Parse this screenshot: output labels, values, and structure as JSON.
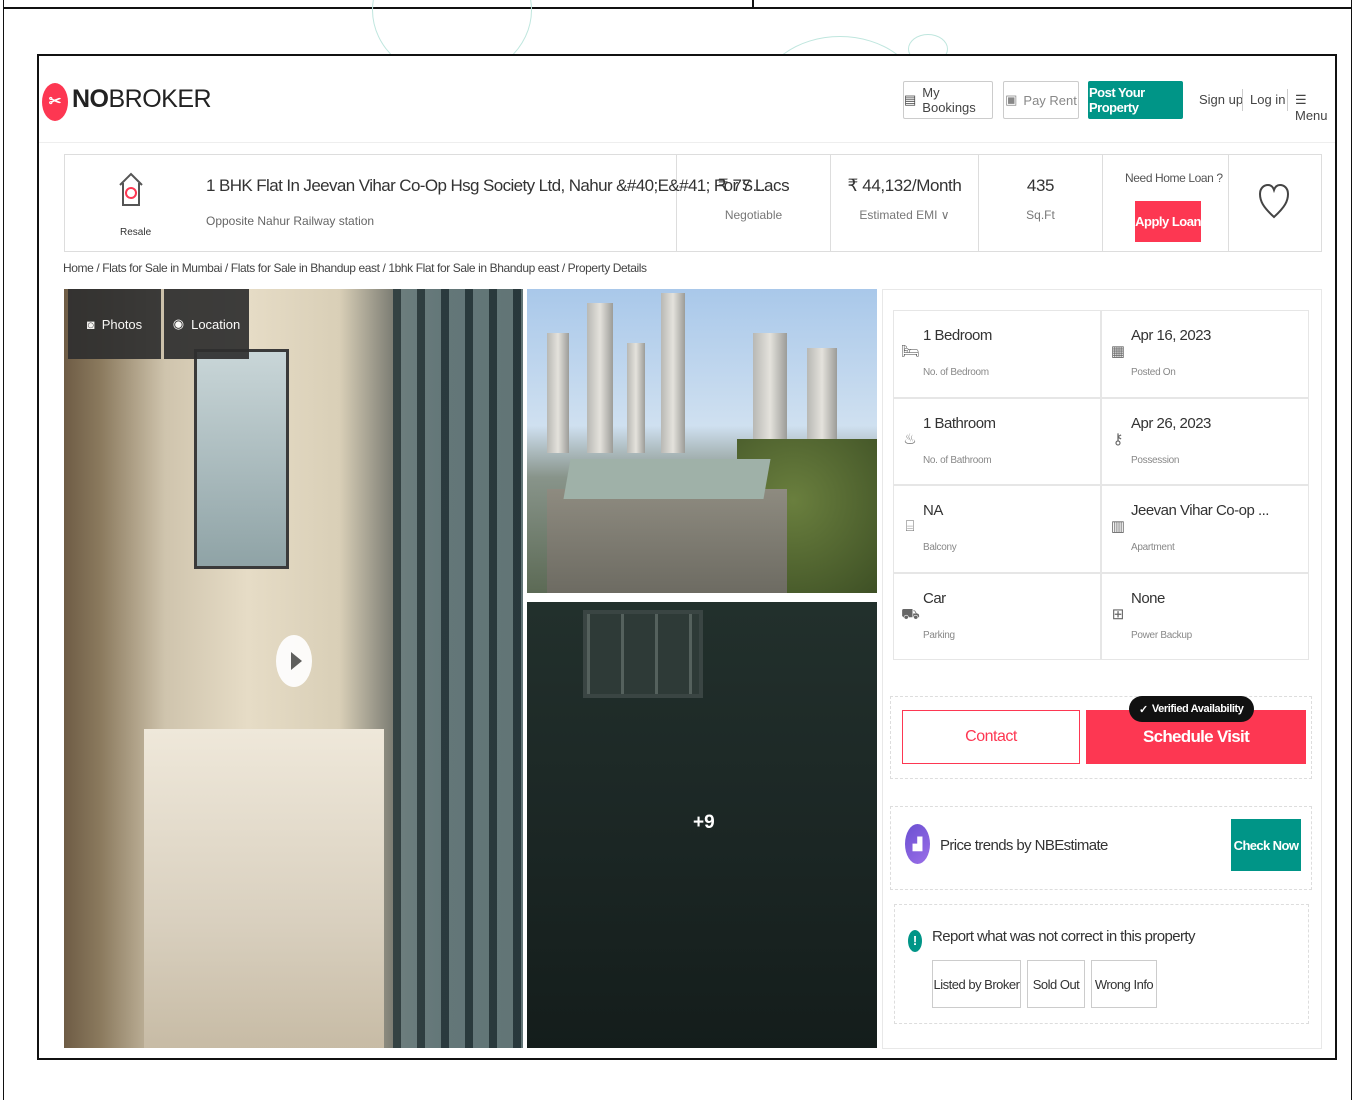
{
  "header": {
    "logo_mark": "✂",
    "logo_bold": "NO",
    "logo_rest": "BROKER",
    "my_bookings": "My Bookings",
    "pay_rent": "Pay Rent",
    "post_property": "Post Your Property",
    "sign_up": "Sign up",
    "log_in": "Log in",
    "menu": "Menu"
  },
  "summary": {
    "type_label": "Resale",
    "title": "1 BHK Flat In Jeevan Vihar Co-Op Hsg Society Ltd, Nahur &#40;E&#41; For S...",
    "subtitle": "Opposite Nahur Railway station",
    "price": "₹ 77 Lacs",
    "price_note": "Negotiable",
    "emi": "₹ 44,132/Month",
    "emi_label": "Estimated EMI ∨",
    "area": "435",
    "area_unit": "Sq.Ft",
    "loan_question": "Need Home Loan ?",
    "apply_loan": "Apply Loan"
  },
  "breadcrumb": "Home / Flats for Sale in Mumbai / Flats for Sale in Bhandup east / 1bhk Flat for Sale in Bhandup east / Property Details",
  "gallery": {
    "photos_tab": "Photos",
    "location_tab": "Location",
    "more_count": "+9"
  },
  "details": [
    {
      "value": "1 Bedroom",
      "label": "No. of Bedroom",
      "icon": "bed-icon",
      "glyph": "🛏"
    },
    {
      "value": "Apr 16, 2023",
      "label": "Posted On",
      "icon": "calendar-icon",
      "glyph": "▦"
    },
    {
      "value": "1 Bathroom",
      "label": "No. of Bathroom",
      "icon": "bathtub-icon",
      "glyph": "♨"
    },
    {
      "value": "Apr 26, 2023",
      "label": "Possession",
      "icon": "key-icon",
      "glyph": "⚷"
    },
    {
      "value": "NA",
      "label": "Balcony",
      "icon": "balcony-icon",
      "glyph": "⌸"
    },
    {
      "value": "Jeevan Vihar Co-op ...",
      "label": "Apartment",
      "icon": "building-icon",
      "glyph": "▥"
    },
    {
      "value": "Car",
      "label": "Parking",
      "icon": "car-icon",
      "glyph": "⛟"
    },
    {
      "value": "None",
      "label": "Power Backup",
      "icon": "battery-icon",
      "glyph": "⊞"
    }
  ],
  "cta": {
    "contact": "Contact",
    "schedule_visit": "Schedule Visit",
    "verified": "Verified Availability"
  },
  "trends": {
    "text": "Price trends by NBEstimate",
    "check": "Check Now"
  },
  "report": {
    "text": "Report what was not correct in this property",
    "options": [
      "Listed by Broker",
      "Sold Out",
      "Wrong Info"
    ]
  },
  "colors": {
    "brand_red": "#fd3752",
    "brand_teal": "#009587"
  }
}
